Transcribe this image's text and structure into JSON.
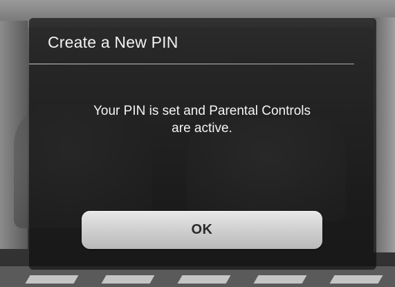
{
  "dialog": {
    "title": "Create a New PIN",
    "message_line1": "Your PIN is set and Parental Controls",
    "message_line2": "are active.",
    "ok_label": "OK"
  }
}
